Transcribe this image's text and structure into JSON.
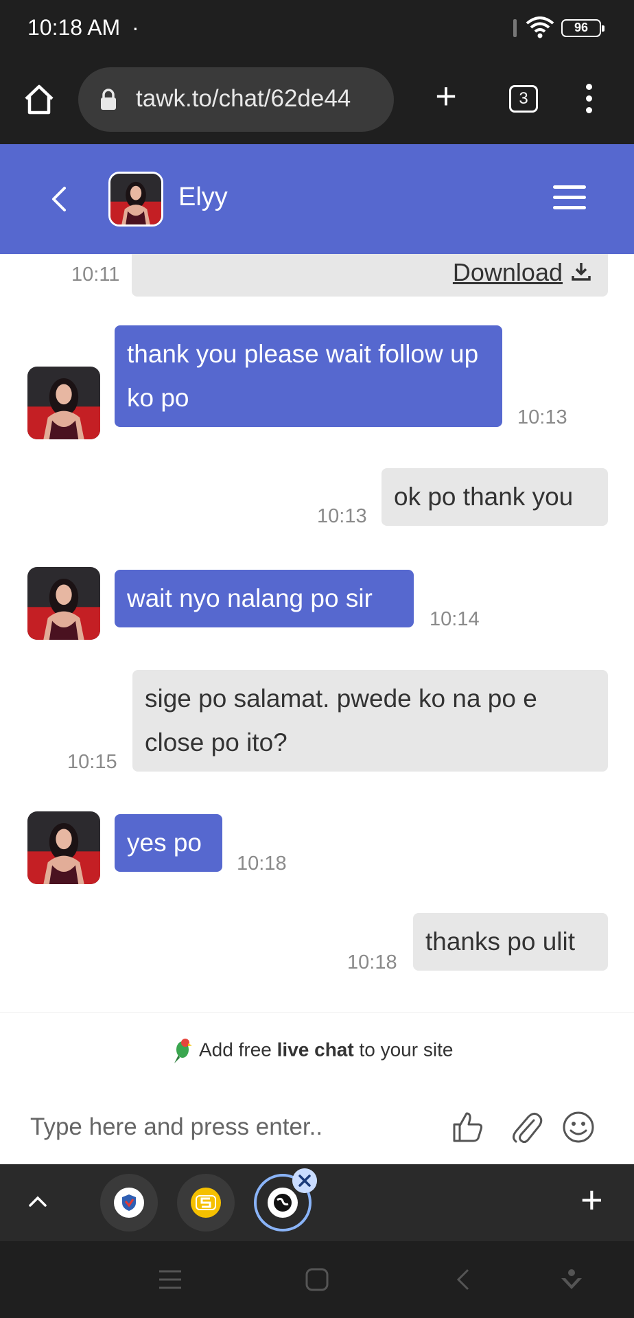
{
  "status_bar": {
    "time": "10:18 AM",
    "dot": "·",
    "battery": "96"
  },
  "browser": {
    "url": "tawk.to/chat/62de44",
    "tab_count": "3",
    "new_tab_glyph": "+"
  },
  "chat_header": {
    "agent_name": "Elyy"
  },
  "messages": [
    {
      "sender": "visitor",
      "time": "10:11",
      "download_label": "Download"
    },
    {
      "sender": "agent",
      "text": "thank you please wait follow up ko po",
      "time": "10:13"
    },
    {
      "sender": "visitor",
      "text": "ok po thank you",
      "time": "10:13"
    },
    {
      "sender": "agent",
      "text": "wait nyo nalang po sir",
      "time": "10:14"
    },
    {
      "sender": "visitor",
      "text": "sige po salamat. pwede ko na po e close po ito?",
      "time": "10:15"
    },
    {
      "sender": "agent",
      "text": "yes po",
      "time": "10:18"
    },
    {
      "sender": "visitor",
      "text": "thanks po ulit",
      "time": "10:18"
    }
  ],
  "branding": {
    "prefix": "Add free ",
    "bold": "live chat",
    "suffix": " to your site"
  },
  "composer": {
    "placeholder": "Type here and press enter.."
  },
  "tab_strip": {
    "plus_glyph": "+"
  },
  "colors": {
    "accent": "#5668cf",
    "visitor_bubble": "#e7e7e7",
    "dark_bg": "#1f1f1f"
  }
}
